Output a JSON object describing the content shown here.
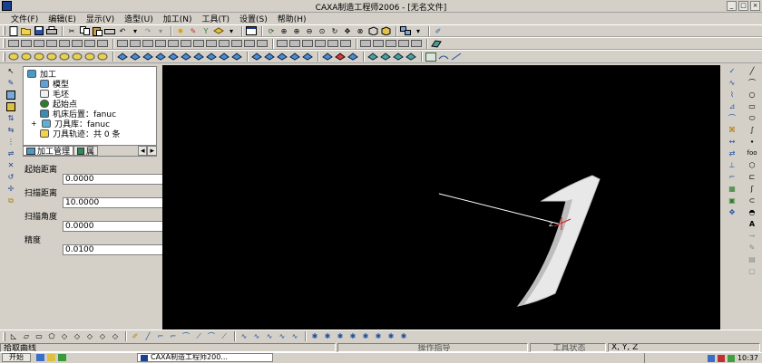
{
  "window": {
    "title": "CAXA制造工程师2006 - [无名文件]",
    "controls": [
      "_",
      "□",
      "×"
    ]
  },
  "menu": [
    "文件(F)",
    "编辑(E)",
    "显示(V)",
    "造型(U)",
    "加工(N)",
    "工具(T)",
    "设置(S)",
    "帮助(H)"
  ],
  "tree": {
    "root": "加工",
    "items": [
      {
        "label": "模型",
        "icon": "model-icon"
      },
      {
        "label": "毛坯",
        "icon": "blank-icon"
      },
      {
        "label": "起始点",
        "icon": "start-point-icon"
      },
      {
        "label": "机床后置：fanuc",
        "icon": "machine-icon"
      },
      {
        "label": "刀具库：fanuc",
        "icon": "tool-library-icon",
        "expander": "+"
      },
      {
        "label": "刀具轨迹：共 0 条",
        "icon": "folder-icon"
      }
    ]
  },
  "tabs": {
    "manage": "加工管理",
    "attr": "属"
  },
  "properties": [
    {
      "label": "起始距离",
      "value": "0.0000"
    },
    {
      "label": "扫描距离",
      "value": "10.0000"
    },
    {
      "label": "扫描角度",
      "value": "0.0000"
    },
    {
      "label": "精度",
      "value": "0.0100"
    }
  ],
  "viewport": {
    "axis_label": "Z",
    "colors": {
      "background": "#000000",
      "surface": "#e8e8e8",
      "axis": "#ffffff",
      "marker": "#d01818"
    }
  },
  "status": {
    "prompt": "拾取曲线",
    "center": "操作指导",
    "tool_state": "工具状态",
    "coords": "X, Y, Z"
  },
  "taskbar": {
    "start": "开始",
    "task": "CAXA制造工程师200...",
    "time": "10:37"
  }
}
